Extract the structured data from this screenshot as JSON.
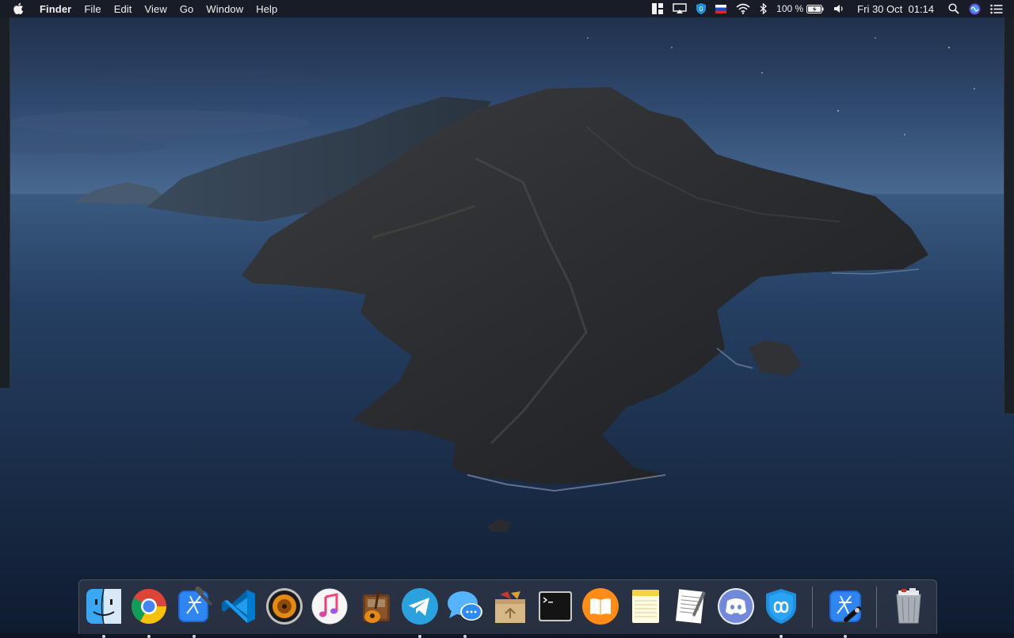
{
  "menubar": {
    "app_name": "Finder",
    "menus": [
      "File",
      "Edit",
      "View",
      "Go",
      "Window",
      "Help"
    ],
    "battery_text": "100 %",
    "clock": "Fri 30 Oct  01:14"
  },
  "status_icons": [
    "magnet-icon",
    "airplay-icon",
    "vpn-shield-icon",
    "russian-flag-icon",
    "wifi-icon",
    "bluetooth-icon",
    "battery-icon",
    "volume-icon",
    "spotlight-search-icon",
    "siri-icon",
    "notification-center-icon"
  ],
  "dock": {
    "apps": [
      {
        "name": "Finder",
        "running": true
      },
      {
        "name": "Google Chrome",
        "running": true
      },
      {
        "name": "Xcode",
        "running": true
      },
      {
        "name": "Visual Studio Code",
        "running": false
      },
      {
        "name": "Vox",
        "running": false
      },
      {
        "name": "iTunes",
        "running": false
      },
      {
        "name": "GarageBand",
        "running": false
      },
      {
        "name": "Telegram",
        "running": true
      },
      {
        "name": "Messages",
        "running": true
      },
      {
        "name": "Archive Utility",
        "running": false
      },
      {
        "name": "Terminal",
        "running": false
      },
      {
        "name": "Books",
        "running": false
      },
      {
        "name": "Notes",
        "running": false
      },
      {
        "name": "TextEdit",
        "running": false
      },
      {
        "name": "Discord",
        "running": false
      },
      {
        "name": "Keepsolid VPN",
        "running": true
      },
      {
        "name": "Instruments",
        "running": true
      },
      {
        "name": "Trash",
        "running": false
      }
    ]
  },
  "colors": {
    "menubar_bg": "#181b24",
    "sky": "#3c5a86",
    "sea": "#1b3150",
    "island": "#2b2b2d"
  }
}
